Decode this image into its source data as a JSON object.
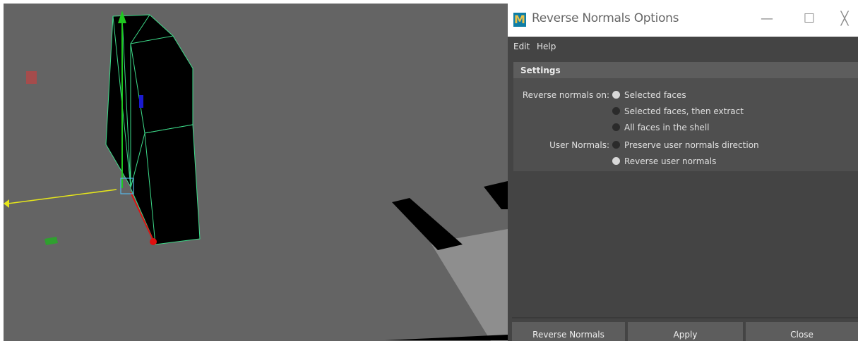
{
  "window": {
    "logo": "M",
    "title": "Reverse Normals Options",
    "controls": {
      "minimize": "—",
      "maximize": "☐",
      "close": "╳"
    }
  },
  "menu": [
    "Edit",
    "Help"
  ],
  "settings": {
    "header": "Settings",
    "reverse_normals_on": {
      "label": "Reverse normals on:",
      "options": [
        "Selected faces",
        "Selected faces, then extract",
        "All faces in the shell"
      ],
      "selected": "Selected faces"
    },
    "user_normals": {
      "label": "User Normals:",
      "options": [
        "Preserve user normals direction",
        "Reverse user normals"
      ],
      "selected": "Reverse user normals"
    }
  },
  "buttons": {
    "reverse_normals": "Reverse Normals",
    "apply": "Apply",
    "close": "Close"
  },
  "colors": {
    "viewport_bg": "#646464",
    "dialog_bg": "#444444",
    "wireframe": "#3ddc8a",
    "axis_x": "#e01010",
    "axis_y": "#1fc81f",
    "axis_z": "#e6e61a"
  }
}
